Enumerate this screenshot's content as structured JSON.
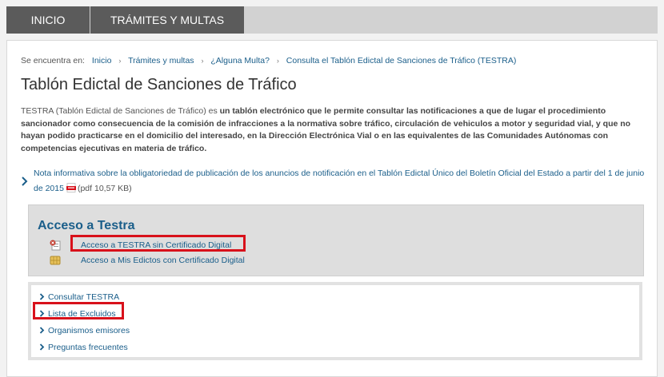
{
  "topnav": {
    "tabs": [
      {
        "label": "INICIO"
      },
      {
        "label": "TRÁMITES Y MULTAS"
      }
    ]
  },
  "breadcrumb": {
    "prefix": "Se encuentra en:",
    "items": [
      {
        "label": "Inicio"
      },
      {
        "label": "Trámites y multas"
      },
      {
        "label": "¿Alguna Multa?"
      },
      {
        "label": "Consulta el Tablón Edictal de Sanciones de Tráfico (TESTRA)"
      }
    ]
  },
  "page": {
    "title": "Tablón Edictal de Sanciones de Tráfico",
    "intro_plain": "TESTRA (Tablón Edictal de Sanciones de Tráfico) es ",
    "intro_bold": "un tablón electrónico que le permite consultar las notificaciones a que de lugar el procedimiento sancionador como consecuencia de la comisión de infracciones a la normativa sobre tráfico, circulación de vehiculos a motor y seguridad vial, y que no hayan podido practicarse en el domicilio del interesado, en la Dirección Electrónica Vial o en las equivalentes de las Comunidades Autónomas con competencias ejecutivas en materia de tráfico."
  },
  "note": {
    "link_text": "Nota informativa sobre la obligatoriedad de publicación de los anuncios de notificación en el Tablón Edictal Único del Boletín Oficial del Estado a partir del 1 de junio de 2015",
    "pdf_icon": "pdf-icon",
    "size": "(pdf 10,57 KB)"
  },
  "access": {
    "title": "Acceso a Testra",
    "items": [
      {
        "label": "Acceso a TESTRA sin Certificado Digital",
        "icon": "certificate-x-icon",
        "highlighted": true
      },
      {
        "label": "Acceso a Mis Edictos con Certificado Digital",
        "icon": "smartcard-chip-icon",
        "highlighted": false
      }
    ]
  },
  "links": {
    "items": [
      {
        "label": "Consultar TESTRA",
        "highlighted": false
      },
      {
        "label": "Lista de Excluidos",
        "highlighted": true
      },
      {
        "label": "Organismos emisores",
        "highlighted": false
      },
      {
        "label": "Preguntas frecuentes",
        "highlighted": false
      }
    ]
  },
  "colors": {
    "nav_tab": "#5b5b5b",
    "nav_bar": "#d2d2d2",
    "link": "#1a5e8a",
    "highlight": "#d8111b",
    "access_bg": "#dedede"
  }
}
